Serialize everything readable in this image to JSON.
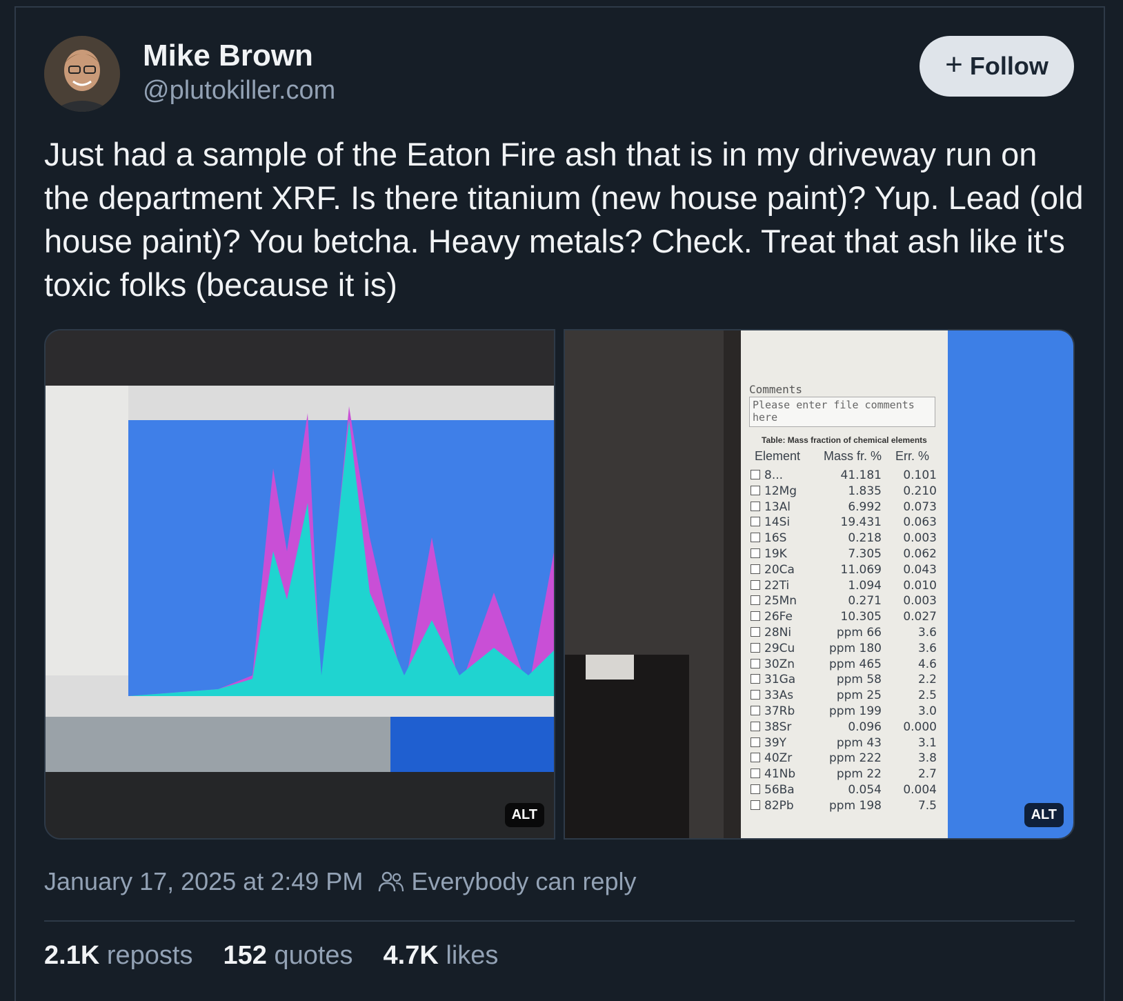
{
  "author": {
    "name": "Mike Brown",
    "handle": "@plutokiller.com"
  },
  "follow_label": "Follow",
  "post_text": "Just had a sample of the Eaton Fire ash that is in my driveway run on the department XRF. Is there titanium (new house paint)? Yup. Lead (old house paint)? You betcha. Heavy metals? Check. Treat that ash like it's toxic folks (because it is)",
  "images": {
    "alt_label": "ALT",
    "xrf_table": {
      "comments_label": "Comments",
      "comments_placeholder": "Please enter file comments here",
      "title": "Table: Mass fraction of chemical elements",
      "headers": [
        "Element",
        "Mass fr. %",
        "Err. %"
      ],
      "rows": [
        [
          "8...",
          "41.181",
          "0.101"
        ],
        [
          "12Mg",
          "1.835",
          "0.210"
        ],
        [
          "13Al",
          "6.992",
          "0.073"
        ],
        [
          "14Si",
          "19.431",
          "0.063"
        ],
        [
          "16S",
          "0.218",
          "0.003"
        ],
        [
          "19K",
          "7.305",
          "0.062"
        ],
        [
          "20Ca",
          "11.069",
          "0.043"
        ],
        [
          "22Ti",
          "1.094",
          "0.010"
        ],
        [
          "25Mn",
          "0.271",
          "0.003"
        ],
        [
          "26Fe",
          "10.305",
          "0.027"
        ],
        [
          "28Ni",
          "ppm 66",
          "3.6"
        ],
        [
          "29Cu",
          "ppm 180",
          "3.6"
        ],
        [
          "30Zn",
          "ppm 465",
          "4.6"
        ],
        [
          "31Ga",
          "ppm 58",
          "2.2"
        ],
        [
          "33As",
          "ppm 25",
          "2.5"
        ],
        [
          "37Rb",
          "ppm 199",
          "3.0"
        ],
        [
          "38Sr",
          "0.096",
          "0.000"
        ],
        [
          "39Y",
          "ppm 43",
          "3.1"
        ],
        [
          "40Zr",
          "ppm 222",
          "3.8"
        ],
        [
          "41Nb",
          "ppm 22",
          "2.7"
        ],
        [
          "56Ba",
          "0.054",
          "0.004"
        ],
        [
          "82Pb",
          "ppm 198",
          "7.5"
        ]
      ]
    }
  },
  "meta": {
    "timestamp": "January 17, 2025 at 2:49 PM",
    "reply_setting": "Everybody can reply"
  },
  "stats": {
    "reposts_count": "2.1K",
    "reposts_label": "reposts",
    "quotes_count": "152",
    "quotes_label": "quotes",
    "likes_count": "4.7K",
    "likes_label": "likes"
  },
  "colors": {
    "background": "#161e27",
    "text": "#f1f3f5",
    "muted": "#93a2b5",
    "follow_bg": "#dfe4ea"
  }
}
